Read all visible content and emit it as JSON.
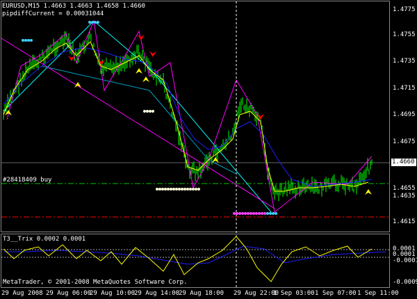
{
  "header": {
    "symbol_line": "EURUSD,M15  1.4663 1.4663 1.4658 1.4660",
    "indicator_line": "pipdiffCurrent = 0.00031044"
  },
  "order_label": "#28418409 buy",
  "current_price": "1.4660",
  "price_axis": [
    "1.4775",
    "1.4755",
    "1.4735",
    "1.4715",
    "1.4695",
    "1.4675",
    "1.4655",
    "1.4635",
    "1.4615"
  ],
  "sub_window": {
    "title": "T3__Trix 0.0002 0.0001",
    "axis": [
      "0.0001",
      "0.0001",
      "-0.0001",
      "-0.0009"
    ]
  },
  "copyright": "MetaTrader, © 2001-2008 MetaQuotes Software Corp.",
  "time_axis": [
    "29 Aug 2008",
    "29 Aug 06:00",
    "29 Aug 10:00",
    "29 Aug 14:00",
    "29 Aug 18:00",
    "29 Aug 22:00",
    "1 Sep 03:00",
    "1 Sep 07:00",
    "1 Sep 11:00"
  ],
  "colors": {
    "background": "#000000",
    "candles": "#00ff00",
    "ma_fast": "#ffff00",
    "ma_slow": "#0000ff",
    "zigzag": "#ff00ff",
    "channel": "#00ffff",
    "buy_arrow": "#ffff00",
    "sell_arrow": "#ff0000"
  }
}
